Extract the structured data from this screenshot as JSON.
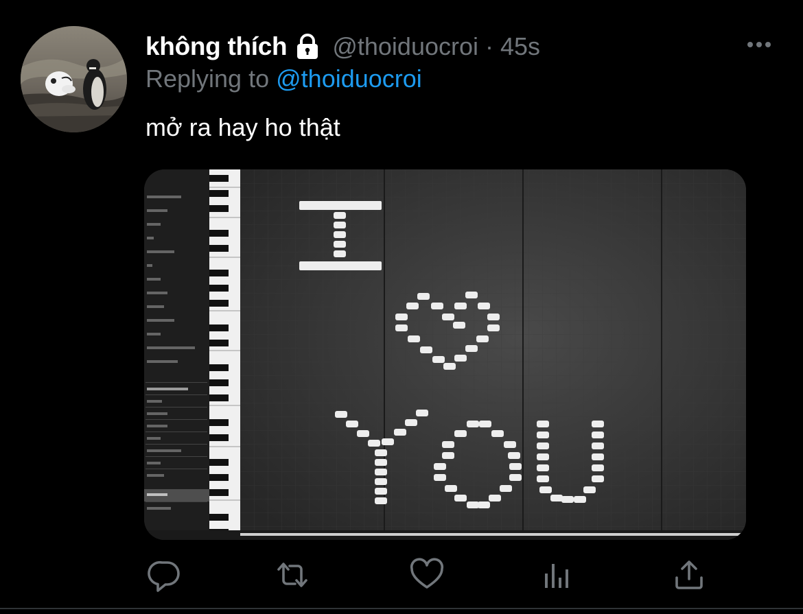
{
  "tweet": {
    "display_name": "không thích",
    "handle": "@thoiduocroi",
    "separator": "·",
    "time": "45s",
    "replying_prefix": "Replying to",
    "replying_to": "@thoiduocroi",
    "text": "mở ra hay ho thật"
  },
  "media": {
    "description": "piano roll screenshot",
    "message": [
      "I",
      "heart",
      "YOU"
    ],
    "sidebar_items": [
      "Bass",
      "Chords",
      "Guitar",
      "Hits",
      "Orchestral",
      "Pads",
      "Percs",
      "Piano",
      "Strings"
    ]
  },
  "actions": {
    "icons": [
      "reply-icon",
      "retweet-icon",
      "like-icon",
      "analytics-icon",
      "share-icon"
    ]
  },
  "colors": {
    "background": "#000000",
    "text_primary": "#ffffff",
    "text_secondary": "#71767b",
    "accent": "#1d9bf0"
  }
}
